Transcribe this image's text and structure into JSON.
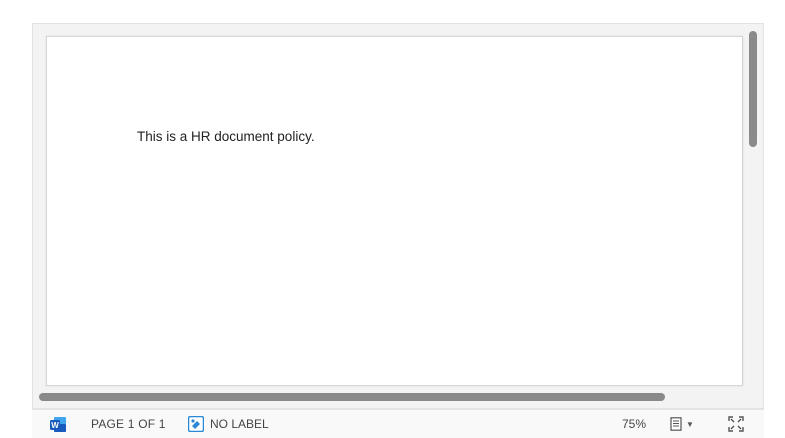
{
  "document": {
    "body_text": "This is a HR document policy."
  },
  "status_bar": {
    "page_indicator": "PAGE 1 OF 1",
    "sensitivity_label": "NO LABEL",
    "zoom": "75%",
    "icons": {
      "app": "word-app-icon",
      "label": "sensitivity-label-icon",
      "layout": "page-layout-icon",
      "fit": "fit-to-screen-icon"
    }
  },
  "colors": {
    "word_blue": "#185abd",
    "label_blue": "#2b88d8",
    "scrollbar": "#8a8a8a"
  }
}
